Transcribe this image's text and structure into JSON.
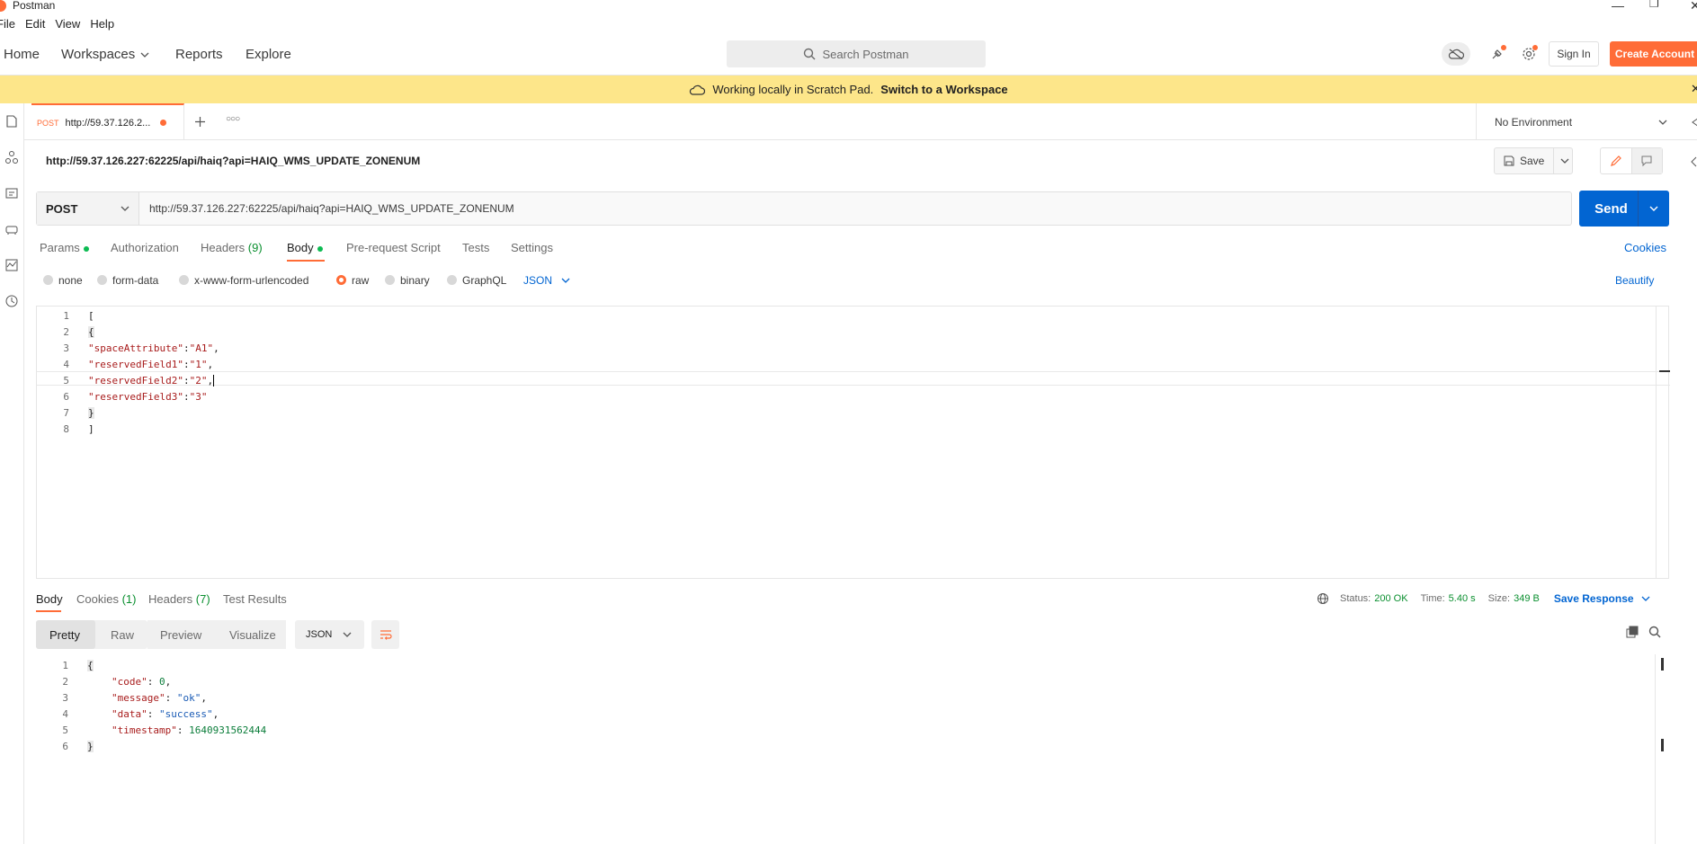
{
  "window": {
    "title": "Postman"
  },
  "menu": [
    "File",
    "Edit",
    "View",
    "Help"
  ],
  "nav": {
    "home": "Home",
    "workspaces": "Workspaces",
    "reports": "Reports",
    "explore": "Explore"
  },
  "search": {
    "placeholder": "Search Postman"
  },
  "auth": {
    "sign_in": "Sign In",
    "create_account": "Create Account"
  },
  "banner": {
    "text": "Working locally in Scratch Pad.",
    "link": "Switch to a Workspace"
  },
  "tab": {
    "method": "POST",
    "label": "http://59.37.126.2..."
  },
  "environment": {
    "selected": "No Environment"
  },
  "request": {
    "name": "http://59.37.126.227:62225/api/haiq?api=HAIQ_WMS_UPDATE_ZONENUM",
    "method": "POST",
    "url": "http://59.37.126.227:62225/api/haiq?api=HAIQ_WMS_UPDATE_ZONENUM",
    "save": "Save",
    "send": "Send"
  },
  "req_tabs": {
    "params": "Params",
    "authorization": "Authorization",
    "headers": "Headers",
    "headers_count": "(9)",
    "body": "Body",
    "prerequest": "Pre-request Script",
    "tests": "Tests",
    "settings": "Settings",
    "cookies": "Cookies"
  },
  "body_types": {
    "none": "none",
    "form_data": "form-data",
    "urlencoded": "x-www-form-urlencoded",
    "raw": "raw",
    "binary": "binary",
    "graphql": "GraphQL",
    "format": "JSON",
    "beautify": "Beautify"
  },
  "request_body": {
    "line_numbers": [
      "1",
      "2",
      "3",
      "4",
      "5",
      "6",
      "7",
      "8"
    ],
    "l1": "[",
    "l2": "{",
    "l3_key": "\"spaceAttribute\"",
    "l3_val": "\"A1\"",
    "l4_key": "\"reservedField1\"",
    "l4_val": "\"1\"",
    "l5_key": "\"reservedField2\"",
    "l5_val": "\"2\"",
    "l6_key": "\"reservedField3\"",
    "l6_val": "\"3\"",
    "l7": "}",
    "l8": "]"
  },
  "response": {
    "tabs": {
      "body": "Body",
      "cookies": "Cookies",
      "cookies_count": "(1)",
      "headers": "Headers",
      "headers_count": "(7)",
      "tests": "Test Results"
    },
    "status_label": "Status:",
    "status": "200 OK",
    "time_label": "Time:",
    "time": "5.40 s",
    "size_label": "Size:",
    "size": "349 B",
    "save": "Save Response",
    "views": {
      "pretty": "Pretty",
      "raw": "Raw",
      "preview": "Preview",
      "visualize": "Visualize"
    },
    "format": "JSON",
    "body": {
      "line_numbers": [
        "1",
        "2",
        "3",
        "4",
        "5",
        "6"
      ],
      "l1": "{",
      "code_key": "\"code\"",
      "code_val": "0",
      "message_key": "\"message\"",
      "message_val": "\"ok\"",
      "data_key": "\"data\"",
      "data_val": "\"success\"",
      "ts_key": "\"timestamp\"",
      "ts_val": "1640931562444",
      "l6": "}"
    }
  },
  "colors": {
    "accent": "#ff6c37",
    "send": "#0265d2",
    "banner": "#fde68a",
    "status_ok": "#0a8f2f"
  }
}
